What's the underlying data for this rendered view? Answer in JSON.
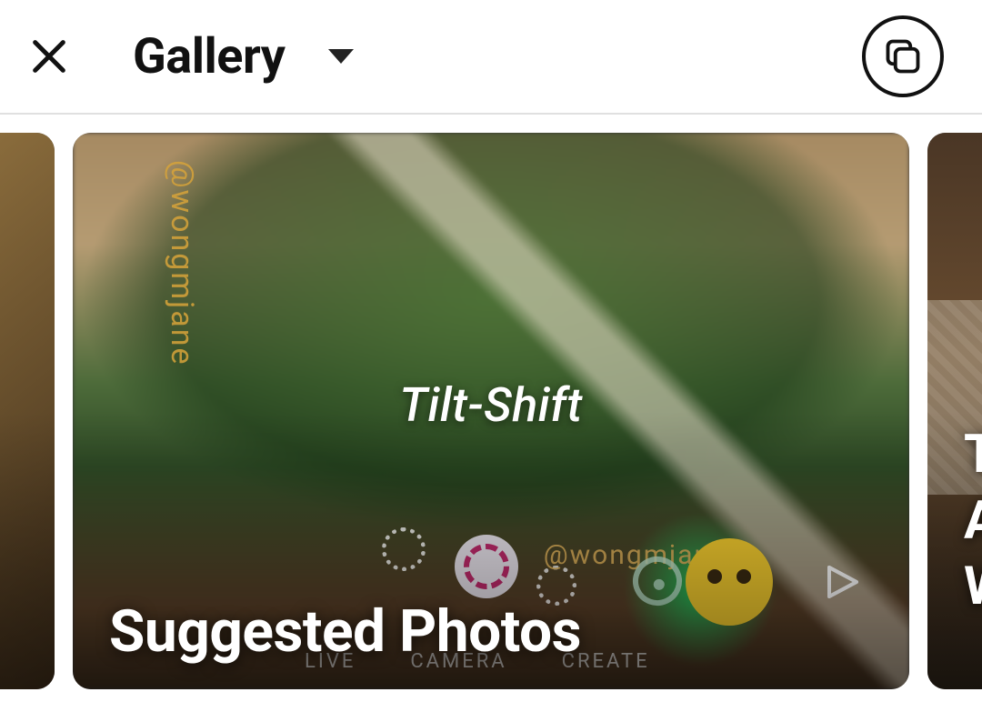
{
  "header": {
    "source_label": "Gallery"
  },
  "cards": {
    "center": {
      "overlay_title": "Tilt-Shift",
      "caption": "Suggested Photos",
      "watermark_vertical": "@wongmjane",
      "watermark_horizontal": "@wongmjane",
      "mini_nav": {
        "a": "LIVE",
        "b": "CAMERA",
        "c": "CREATE"
      }
    },
    "right": {
      "caption_line1": "T",
      "caption_line2": "A",
      "caption_line3": "W"
    }
  },
  "icons": {
    "close": "close-icon",
    "caret": "chevron-down-icon",
    "multiselect": "multiselect-icon"
  }
}
